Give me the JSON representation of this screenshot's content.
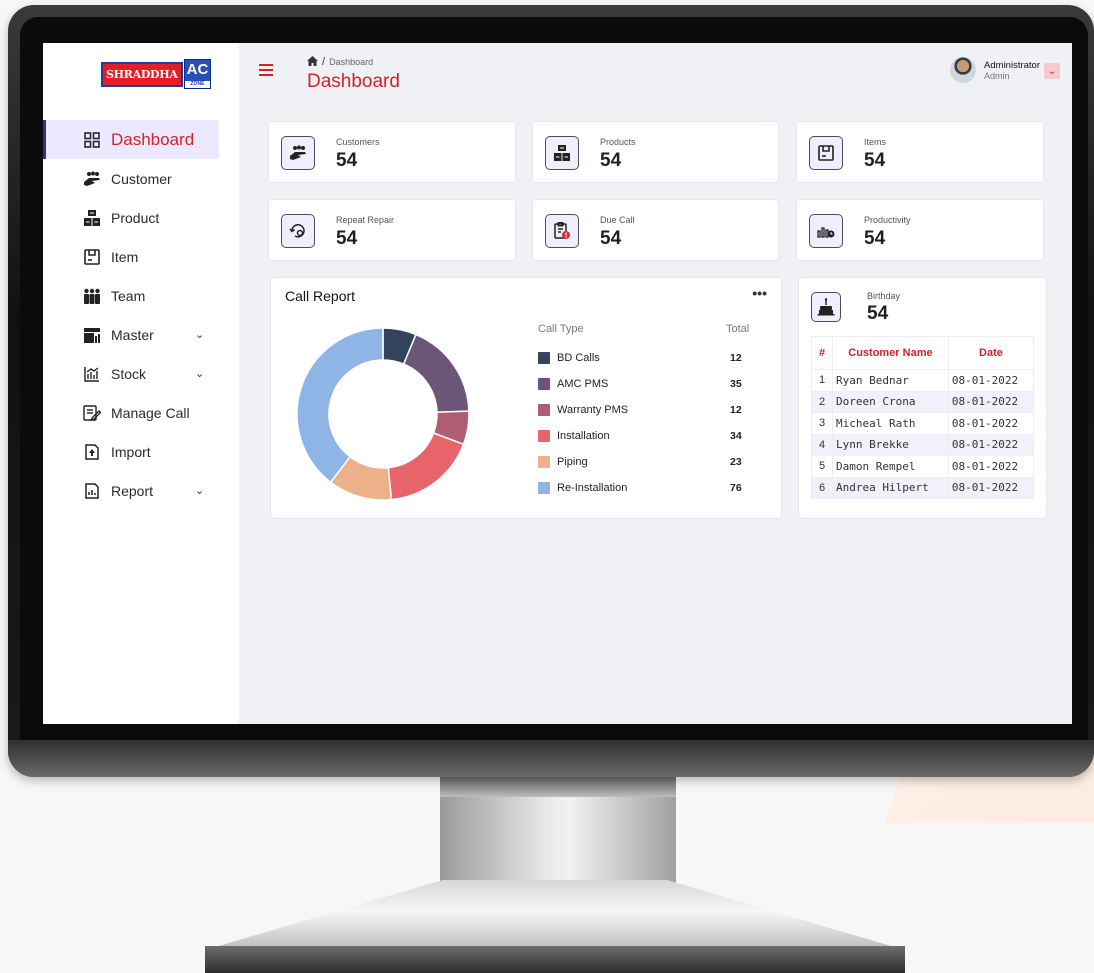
{
  "brand": {
    "logo_text": "SHRADDHA",
    "logo_ac": "AC",
    "logo_zone": "ZONE"
  },
  "sidebar": {
    "items": [
      {
        "label": "Dashboard",
        "icon": "grid-icon",
        "active": true
      },
      {
        "label": "Customer",
        "icon": "customer-hands-icon"
      },
      {
        "label": "Product",
        "icon": "boxes-icon"
      },
      {
        "label": "Item",
        "icon": "item-box-icon"
      },
      {
        "label": "Team",
        "icon": "team-icon"
      },
      {
        "label": "Master",
        "icon": "master-icon",
        "expandable": true
      },
      {
        "label": "Stock",
        "icon": "stock-chart-icon",
        "expandable": true
      },
      {
        "label": "Manage Call",
        "icon": "edit-list-icon"
      },
      {
        "label": "Import",
        "icon": "import-file-icon"
      },
      {
        "label": "Report",
        "icon": "report-file-icon",
        "expandable": true
      }
    ]
  },
  "header": {
    "breadcrumb": "Dashboard",
    "breadcrumb_sep": "/",
    "title": "Dashboard",
    "user_name": "Administrator",
    "user_role": "Admin"
  },
  "stats": [
    {
      "label": "Customers",
      "value": "54",
      "icon": "customers-icon"
    },
    {
      "label": "Products",
      "value": "54",
      "icon": "products-icon"
    },
    {
      "label": "Items",
      "value": "54",
      "icon": "items-icon"
    },
    {
      "label": "Repeat Repair",
      "value": "54",
      "icon": "repeat-repair-icon"
    },
    {
      "label": "Due Call",
      "value": "54",
      "icon": "due-call-icon"
    },
    {
      "label": "Productivity",
      "value": "54",
      "icon": "productivity-icon"
    }
  ],
  "call_report": {
    "title": "Call Report",
    "more": "•••",
    "col_type": "Call Type",
    "col_total": "Total",
    "rows": [
      {
        "label": "BD Calls",
        "value": "12",
        "color": "#34435c"
      },
      {
        "label": "AMC PMS",
        "value": "35",
        "color": "#6b5677"
      },
      {
        "label": "Warranty PMS",
        "value": "12",
        "color": "#b05c73"
      },
      {
        "label": "Installation",
        "value": "34",
        "color": "#e8646b"
      },
      {
        "label": "Piping",
        "value": "23",
        "color": "#ecb08a"
      },
      {
        "label": "Re-Installation",
        "value": "76",
        "color": "#8fb4e6"
      }
    ]
  },
  "birthday": {
    "label": "Birthday",
    "value": "54",
    "headers": [
      "#",
      "Customer Name",
      "Date"
    ],
    "rows": [
      [
        "1",
        "Ryan Bednar",
        "08-01-2022"
      ],
      [
        "2",
        "Doreen Crona",
        "08-01-2022"
      ],
      [
        "3",
        "Micheal Rath",
        "08-01-2022"
      ],
      [
        "4",
        "Lynn Brekke",
        "08-01-2022"
      ],
      [
        "5",
        "Damon Rempel",
        "08-01-2022"
      ],
      [
        "6",
        "Andrea Hilpert",
        "08-01-2022"
      ]
    ]
  }
}
